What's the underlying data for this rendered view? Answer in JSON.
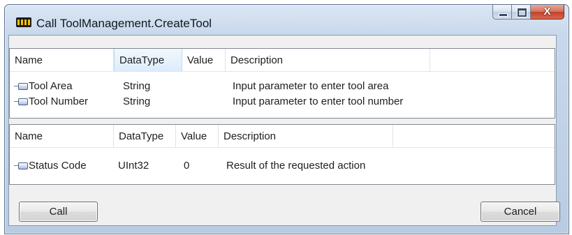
{
  "window": {
    "title": "Call ToolManagement.CreateTool"
  },
  "inputs": {
    "headers": {
      "name": "Name",
      "datatype": "DataType",
      "value": "Value",
      "description": "Description"
    },
    "rows": [
      {
        "name": "Tool Area",
        "datatype": "String",
        "value": "",
        "description": "Input parameter to enter tool area"
      },
      {
        "name": "Tool Number",
        "datatype": "String",
        "value": "",
        "description": "Input parameter to enter tool number"
      }
    ]
  },
  "outputs": {
    "headers": {
      "name": "Name",
      "datatype": "DataType",
      "value": "Value",
      "description": "Description"
    },
    "rows": [
      {
        "name": "Status Code",
        "datatype": "UInt32",
        "value": "0",
        "description": "Result of the requested action"
      }
    ]
  },
  "buttons": {
    "call": "Call",
    "cancel": "Cancel"
  }
}
